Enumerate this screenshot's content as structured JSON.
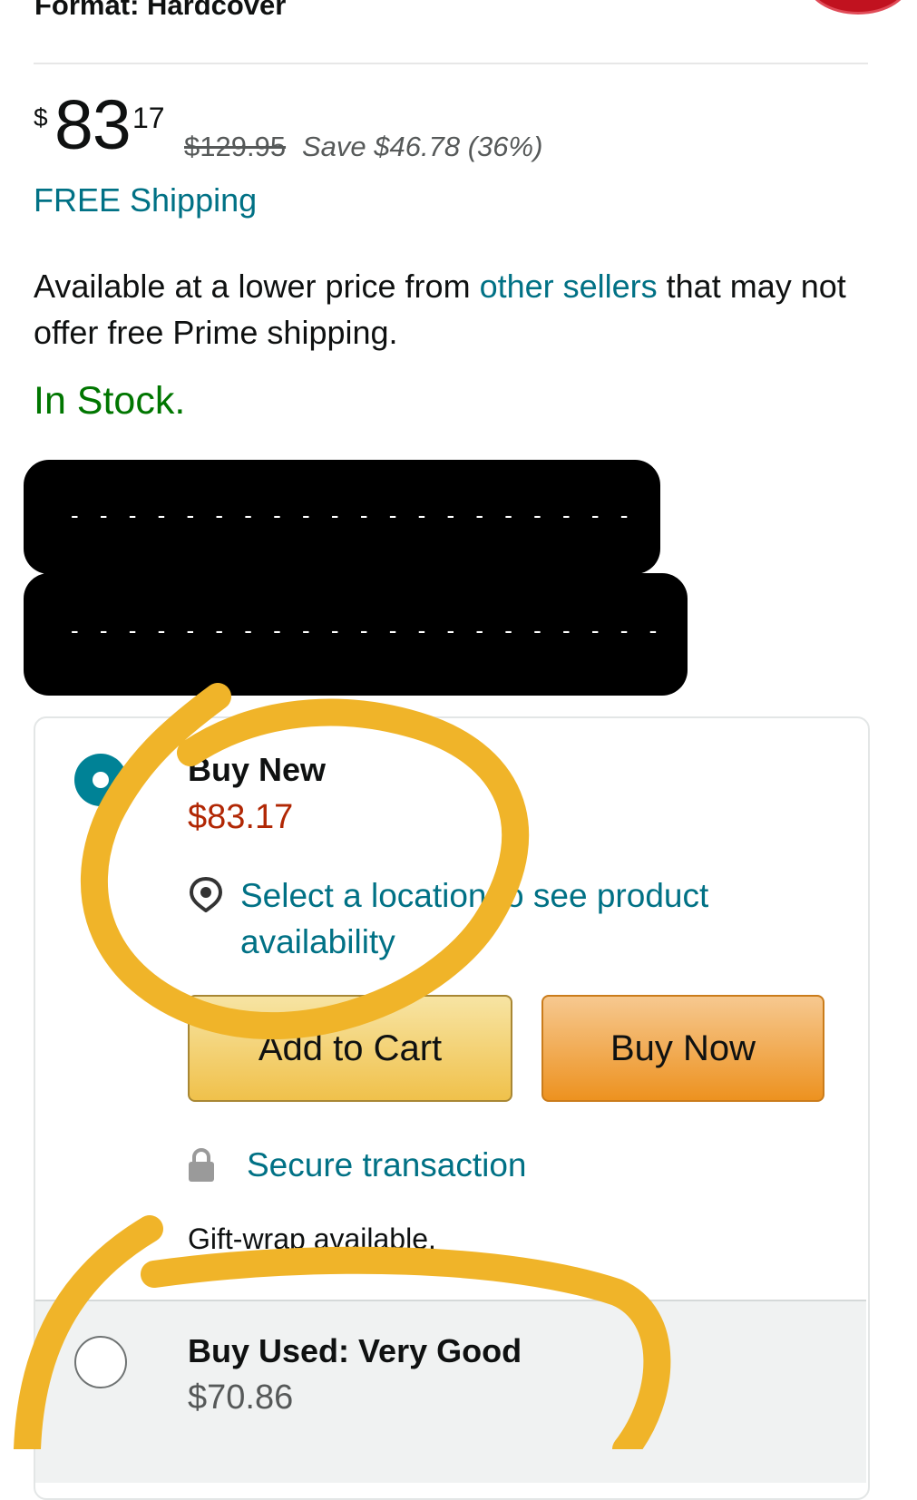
{
  "product": {
    "format_label": "Format: Hardcover"
  },
  "pricing": {
    "currency_symbol": "$",
    "price_whole": "83",
    "price_fraction": "17",
    "list_price": "$129.95",
    "savings": "Save $46.78 (36%)",
    "shipping": "FREE Shipping"
  },
  "availability": {
    "text_before": "Available at a lower price from ",
    "link": "other sellers",
    "text_after": " that may not offer free Prime shipping.",
    "stock": "In Stock."
  },
  "redacted": {
    "line1": "- - - - - - - - - - - - - - - - - - - -",
    "line2": "- - - - - - - - - - - - - - - - - - - - -"
  },
  "buybox": {
    "new_option": {
      "label": "Buy New",
      "price": "$83.17",
      "location_text": "Select a location to see product availability",
      "location_icon": "location-pin-icon"
    },
    "add_to_cart": "Add to Cart",
    "buy_now": "Buy Now",
    "secure_text": "Secure transaction",
    "secure_icon": "lock-icon",
    "gift_text": "Gift-wrap available.",
    "used_option": {
      "label": "Buy Used: Very Good",
      "price": "$70.86"
    }
  },
  "colors": {
    "link": "#007185",
    "price_red": "#b12704",
    "in_stock": "#007600",
    "radio_selected": "#008296",
    "annotation": "#f0b429"
  }
}
